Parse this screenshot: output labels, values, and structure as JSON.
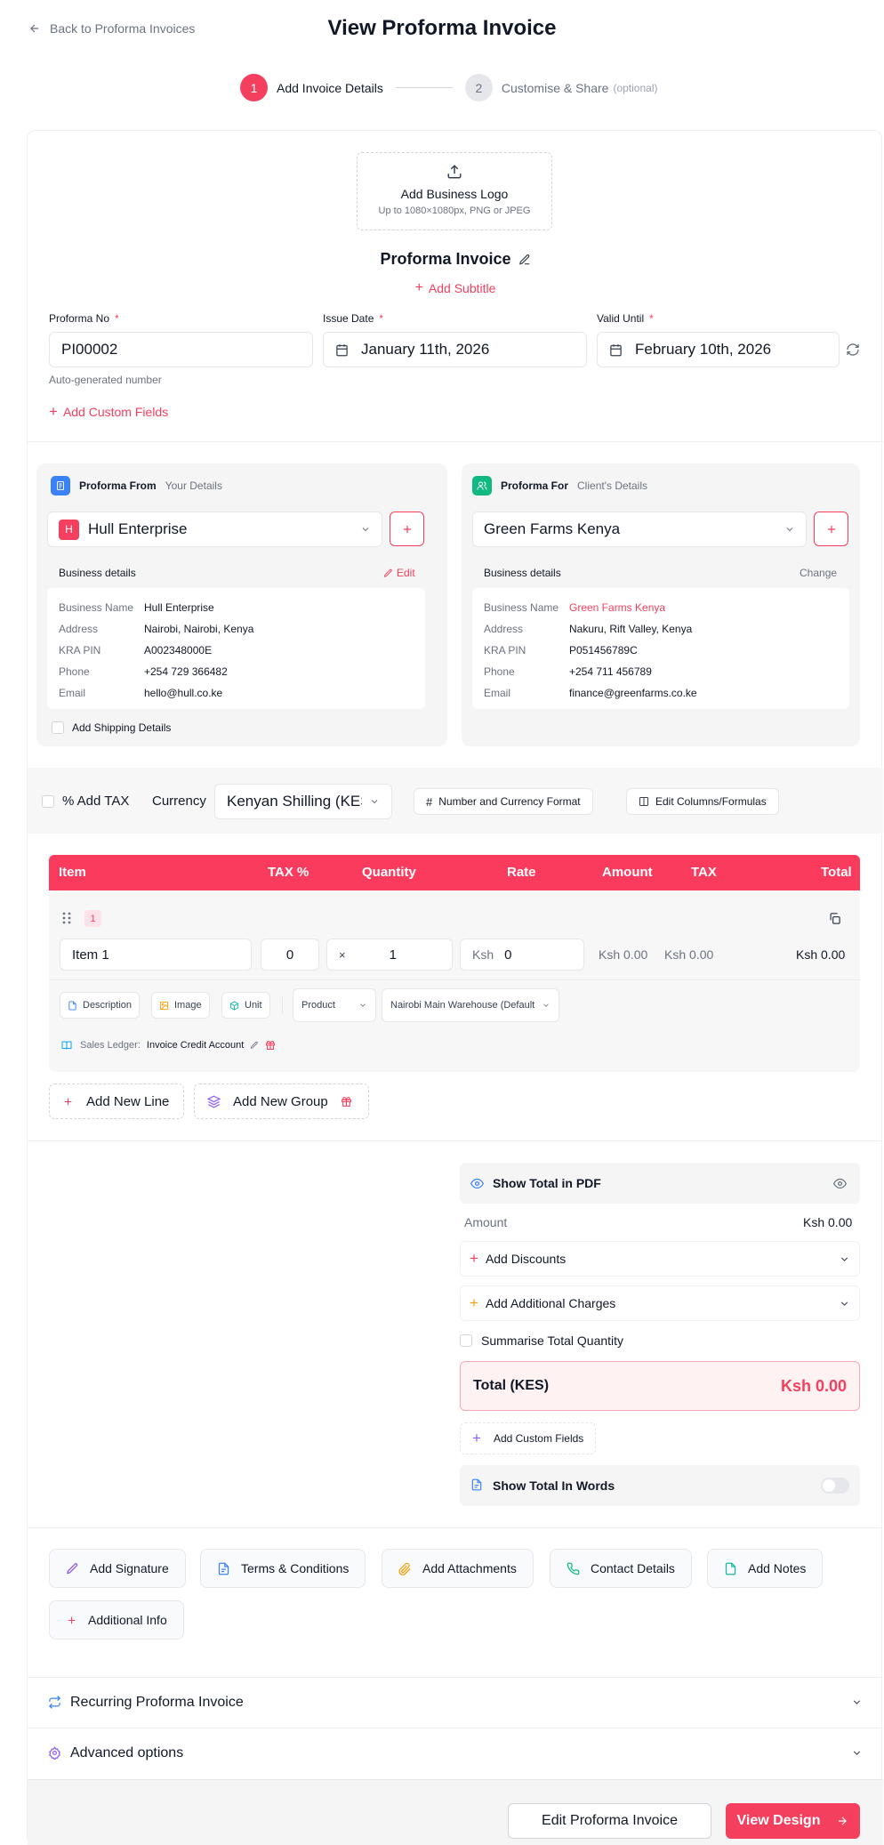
{
  "header": {
    "back_label": "Back to Proforma Invoices",
    "title": "View Proforma Invoice"
  },
  "stepper": {
    "step1_num": "1",
    "step1_label": "Add Invoice Details",
    "step2_num": "2",
    "step2_label": "Customise & Share",
    "step2_hint": "(optional)"
  },
  "logo": {
    "title": "Add Business Logo",
    "hint": "Up to 1080×1080px, PNG or JPEG"
  },
  "doc": {
    "title": "Proforma Invoice",
    "add_subtitle": "Add Subtitle"
  },
  "fields": {
    "proforma_no_label": "Proforma No",
    "proforma_no": "PI00002",
    "proforma_no_hint": "Auto-generated number",
    "issue_date_label": "Issue Date",
    "issue_date": "January 11th, 2026",
    "valid_until_label": "Valid Until",
    "valid_until": "February 10th, 2026",
    "add_custom_fields": "Add Custom Fields"
  },
  "from": {
    "title": "Proforma From",
    "subtitle": "Your Details",
    "selected": "Hull Enterprise",
    "avatar_letter": "H",
    "details_title": "Business details",
    "edit_label": "Edit",
    "rows": [
      {
        "k": "Business Name",
        "v": "Hull Enterprise"
      },
      {
        "k": "Address",
        "v": "Nairobi, Nairobi, Kenya"
      },
      {
        "k": "KRA PIN",
        "v": "A002348000E"
      },
      {
        "k": "Phone",
        "v": "+254 729 366482"
      },
      {
        "k": "Email",
        "v": "hello@hull.co.ke"
      }
    ],
    "shipping_label": "Add Shipping Details"
  },
  "for": {
    "title": "Proforma For",
    "subtitle": "Client's Details",
    "selected": "Green Farms Kenya",
    "details_title": "Business details",
    "change_label": "Change",
    "rows": [
      {
        "k": "Business Name",
        "v": "Green Farms Kenya"
      },
      {
        "k": "Address",
        "v": "Nakuru, Rift Valley, Kenya"
      },
      {
        "k": "KRA PIN",
        "v": "P051456789C"
      },
      {
        "k": "Phone",
        "v": "+254 711 456789"
      },
      {
        "k": "Email",
        "v": "finance@greenfarms.co.ke"
      }
    ]
  },
  "toolbar": {
    "add_tax": "% Add TAX",
    "currency_label": "Currency",
    "currency_value": "Kenyan Shilling (KES)",
    "number_format": "Number and Currency Format",
    "edit_columns": "Edit Columns/Formulas"
  },
  "table": {
    "headers": {
      "item": "Item",
      "tax_pct": "TAX %",
      "quantity": "Quantity",
      "rate": "Rate",
      "amount": "Amount",
      "tax": "TAX",
      "total": "Total"
    },
    "line": {
      "index": "1",
      "item": "Item 1",
      "tax": "0",
      "times": "×",
      "qty": "1",
      "rate_prefix": "Ksh",
      "rate": "0",
      "amount": "Ksh 0.00",
      "tax_amount": "Ksh 0.00",
      "total": "Ksh 0.00",
      "tag_description": "Description",
      "tag_image": "Image",
      "tag_unit": "Unit",
      "type": "Product",
      "warehouse": "Nairobi Main Warehouse (Default)",
      "ledger_label": "Sales Ledger:",
      "ledger_value": "Invoice Credit Account"
    }
  },
  "lines": {
    "add_line": "Add New Line",
    "add_group": "Add New Group"
  },
  "summary": {
    "show_total_pdf": "Show Total in PDF",
    "amount_label": "Amount",
    "amount_value": "Ksh 0.00",
    "add_discounts": "Add Discounts",
    "add_charges": "Add Additional Charges",
    "summarise_qty": "Summarise Total Quantity",
    "total_label": "Total (KES)",
    "total_value": "Ksh 0.00",
    "add_custom_fields": "Add Custom Fields",
    "total_in_words": "Show Total In Words"
  },
  "actions": {
    "signature": "Add Signature",
    "terms": "Terms & Conditions",
    "attachments": "Add Attachments",
    "contact": "Contact Details",
    "notes": "Add Notes",
    "additional": "Additional Info"
  },
  "accordions": {
    "recurring": "Recurring Proforma Invoice",
    "advanced": "Advanced options"
  },
  "footer": {
    "edit": "Edit Proforma Invoice",
    "view": "View Design"
  },
  "colors": {
    "accent": "#f43f5e",
    "blue": "#3b82f6",
    "green": "#10b981",
    "purple": "#8b5cf6",
    "orange": "#f59e0b",
    "teal": "#14b8a6"
  }
}
